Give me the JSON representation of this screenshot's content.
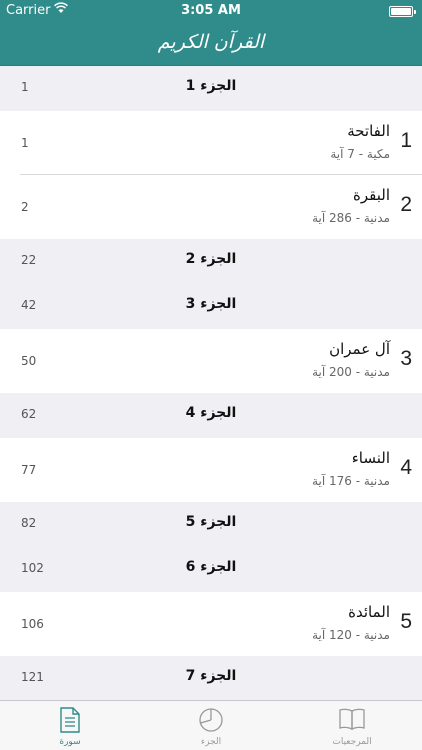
{
  "status_bar": {
    "carrier": "Carrier",
    "time": "3:05 AM"
  },
  "header": {
    "title": "القرآن الكريم"
  },
  "list": {
    "rows": [
      {
        "type": "juz",
        "page": "1",
        "label": "الجزء 1"
      },
      {
        "type": "surah",
        "page": "1",
        "number": "1",
        "name": "الفاتحة",
        "info": "مكية - 7 آية"
      },
      {
        "type": "surah",
        "page": "2",
        "number": "2",
        "name": "البقرة",
        "info": "مدنية - 286 آية"
      },
      {
        "type": "juz",
        "page": "22",
        "label": "الجزء 2"
      },
      {
        "type": "juz",
        "page": "42",
        "label": "الجزء 3"
      },
      {
        "type": "surah",
        "page": "50",
        "number": "3",
        "name": "آل عمران",
        "info": "مدنية - 200 آية"
      },
      {
        "type": "juz",
        "page": "62",
        "label": "الجزء 4"
      },
      {
        "type": "surah",
        "page": "77",
        "number": "4",
        "name": "النساء",
        "info": "مدنية - 176 آية"
      },
      {
        "type": "juz",
        "page": "82",
        "label": "الجزء 5"
      },
      {
        "type": "juz",
        "page": "102",
        "label": "الجزء 6"
      },
      {
        "type": "surah",
        "page": "106",
        "number": "5",
        "name": "المائدة",
        "info": "مدنية - 120 آية"
      },
      {
        "type": "juz",
        "page": "121",
        "label": "الجزء 7"
      }
    ]
  },
  "tab_bar": {
    "tabs": [
      {
        "label": "سورة",
        "icon": "document-icon",
        "active": true
      },
      {
        "label": "الجزء",
        "icon": "pie-chart-icon",
        "active": false
      },
      {
        "label": "المرجعيات",
        "icon": "book-icon",
        "active": false
      }
    ]
  },
  "colors": {
    "accent": "#2f8c8a",
    "section_background": "#efeff4",
    "inactive_tab": "#999999"
  }
}
